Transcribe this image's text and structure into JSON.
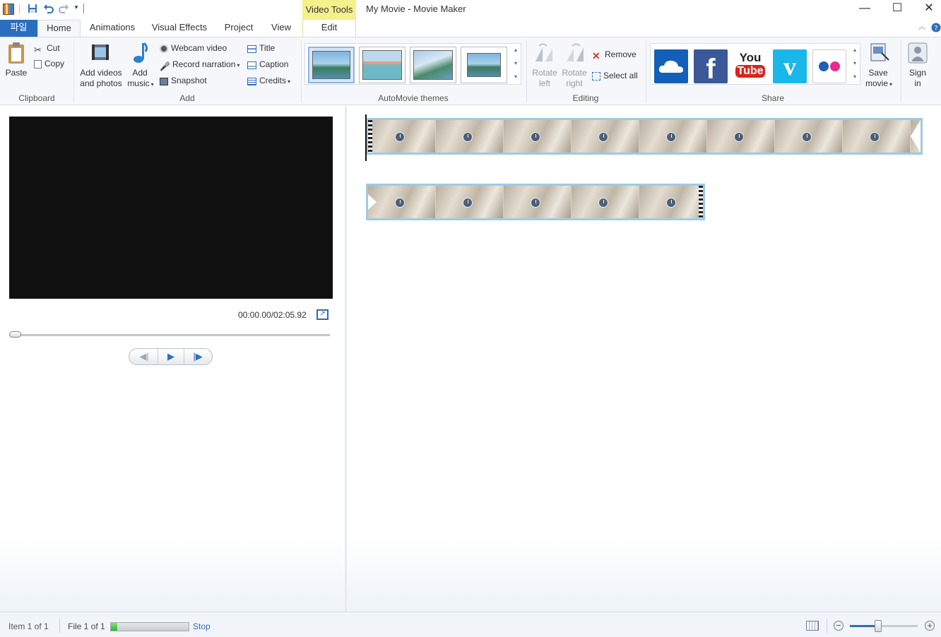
{
  "window": {
    "context_tab": "Video Tools",
    "title": "My Movie - Movie Maker",
    "minimize": "—",
    "maximize": "☐",
    "close": "✕"
  },
  "tabs": [
    "파일",
    "Home",
    "Animations",
    "Visual Effects",
    "Project",
    "View",
    "Edit"
  ],
  "ribbon": {
    "clipboard": {
      "label": "Clipboard",
      "paste": "Paste",
      "cut": "Cut",
      "copy": "Copy"
    },
    "add": {
      "label": "Add",
      "add_videos_1": "Add videos",
      "add_videos_2": "and photos",
      "add_music_1": "Add",
      "add_music_2": "music",
      "webcam": "Webcam video",
      "narration": "Record narration",
      "snapshot": "Snapshot",
      "title": "Title",
      "caption": "Caption",
      "credits": "Credits"
    },
    "themes": {
      "label": "AutoMovie themes"
    },
    "editing": {
      "label": "Editing",
      "rotate_left_1": "Rotate",
      "rotate_left_2": "left",
      "rotate_right_1": "Rotate",
      "rotate_right_2": "right",
      "remove": "Remove",
      "select_all": "Select all"
    },
    "share": {
      "label": "Share",
      "youtube_1": "You",
      "youtube_2": "Tube",
      "save_movie_1": "Save",
      "save_movie_2": "movie",
      "sign_in_1": "Sign",
      "sign_in_2": "in"
    }
  },
  "player": {
    "timecode": "00:00.00/02:05.92",
    "seek_position": 0
  },
  "status": {
    "item": "Item 1 of 1",
    "file": "File 1 of 1",
    "stop": "Stop",
    "progress": 0.08,
    "zoom_level": 0.42
  },
  "colors": {
    "accent": "#2a6ebf",
    "context_tab": "#f4f08a",
    "clip_border": "#9ecae2"
  },
  "icons": [
    "app-icon",
    "save-icon",
    "undo-icon",
    "redo-icon",
    "customize-icon",
    "paste-icon",
    "cut-icon",
    "copy-icon",
    "film-icon",
    "music-note-icon",
    "webcam-icon",
    "microphone-icon",
    "snapshot-icon",
    "title-icon",
    "caption-icon",
    "credits-icon",
    "rotate-left-icon",
    "rotate-right-icon",
    "remove-x-icon",
    "select-all-icon",
    "onedrive-icon",
    "facebook-icon",
    "youtube-icon",
    "vimeo-icon",
    "flickr-icon",
    "save-movie-icon",
    "sign-in-icon",
    "fullscreen-icon",
    "previous-frame-icon",
    "play-icon",
    "next-frame-icon",
    "collapse-ribbon-icon",
    "help-icon",
    "storyboard-view-icon",
    "zoom-out-icon",
    "zoom-in-icon"
  ]
}
